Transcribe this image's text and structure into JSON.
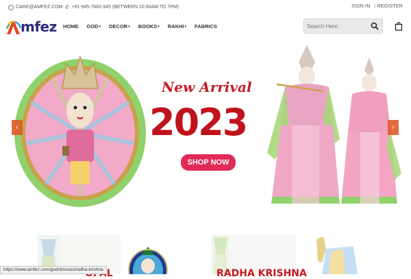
{
  "topbar": {
    "email": "CARE@AMFEZ.COM",
    "phone": "+91-945-7682-945 (BETWEEN 10:00AM TO 7PM)",
    "sign_in": "SIGN IN",
    "separator": "|",
    "register": "REGISTER"
  },
  "brand": {
    "logo_text": "mfez",
    "accent": "#2c2b7a"
  },
  "nav": {
    "items": [
      {
        "label": "HOME",
        "dropdown": false
      },
      {
        "label": "GOD",
        "dropdown": true
      },
      {
        "label": "DECOR",
        "dropdown": true
      },
      {
        "label": "BOOKS",
        "dropdown": true
      },
      {
        "label": "RAKHI",
        "dropdown": true
      },
      {
        "label": "FABRICS",
        "dropdown": false
      }
    ],
    "caret": "▾"
  },
  "search": {
    "placeholder": "Search Here..",
    "icon": "search-icon"
  },
  "cart": {
    "icon": "shopping-bag-icon"
  },
  "hero": {
    "headline": "New Arrival",
    "year": "2023",
    "cta": "SHOP NOW",
    "cta_color": "#e02a58",
    "headline_color": "#c21d25",
    "prev_icon": "‹",
    "next_icon": "›",
    "arrow_color": "#e05a2b"
  },
  "thumbnails": {
    "left_label": "OPAL",
    "right_label": "RADHA KRISHNA"
  },
  "status_bar": {
    "url": "https://www.amfez.com/god/dresses/radha-krishna"
  }
}
